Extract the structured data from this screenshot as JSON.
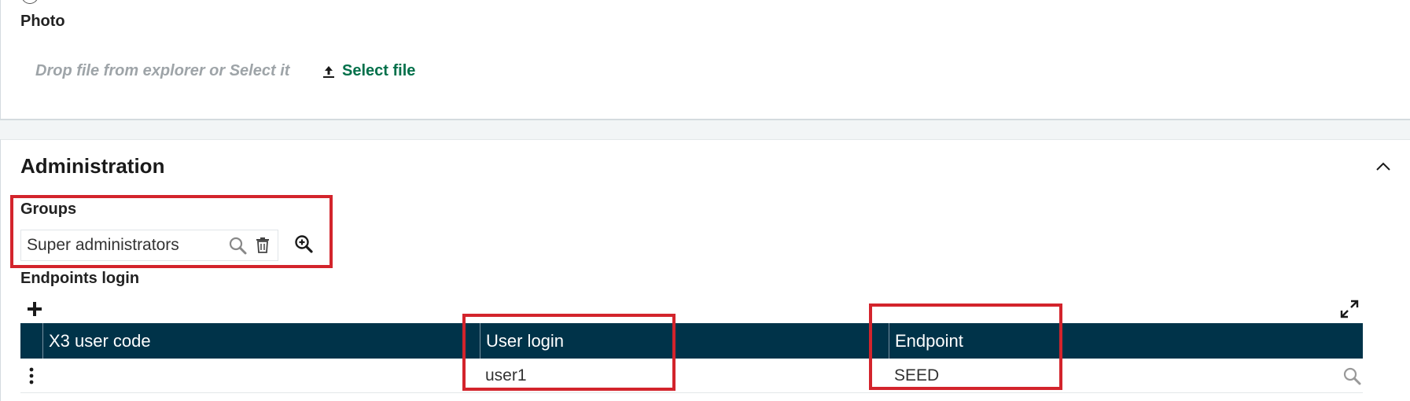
{
  "photo": {
    "label": "Photo",
    "drop_hint": "Drop file from explorer or Select it",
    "select_file_label": "Select file"
  },
  "administration": {
    "title": "Administration",
    "groups": {
      "label": "Groups",
      "value": "Super administrators"
    },
    "endpoints": {
      "label": "Endpoints login",
      "columns": [
        "X3 user code",
        "User login",
        "Endpoint"
      ],
      "rows": [
        {
          "x3_user_code": "",
          "user_login": "user1",
          "endpoint": "SEED"
        }
      ]
    }
  },
  "icons": {
    "upload": "upload-icon",
    "search": "search-icon",
    "trash": "trash-icon",
    "zoom": "zoom-in-icon",
    "add": "plus-icon",
    "expand": "expand-icon",
    "collapse": "chevron-up-icon",
    "row_menu": "vertical-dots-icon"
  },
  "colors": {
    "accent_green": "#00704a",
    "grid_header": "#003349",
    "highlight_red": "#d3242c",
    "hint_gray": "#9ea4a8"
  }
}
